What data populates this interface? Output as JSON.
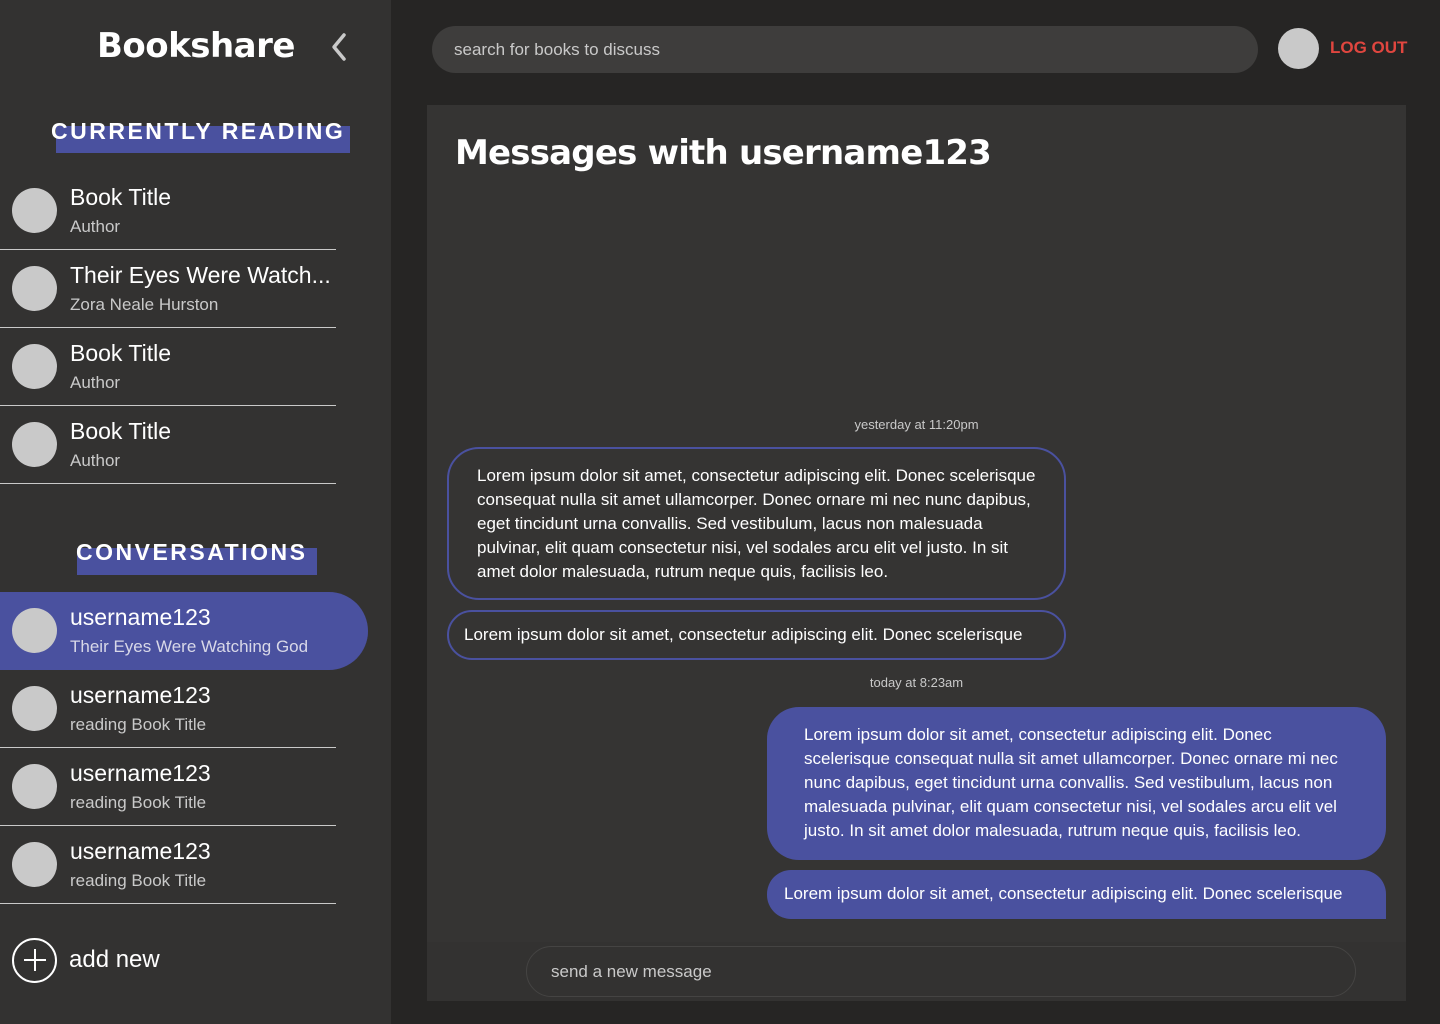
{
  "app": {
    "brand": "Bookshare"
  },
  "sidebar": {
    "currently_reading_heading": "CURRENTLY READING",
    "books": [
      {
        "title": "Book Title",
        "author": "Author"
      },
      {
        "title": "Their Eyes Were Watch...",
        "author": "Zora Neale Hurston"
      },
      {
        "title": "Book Title",
        "author": "Author"
      },
      {
        "title": "Book Title",
        "author": "Author"
      }
    ],
    "conversations_heading": "CONVERSATIONS",
    "conversations": [
      {
        "user": "username123",
        "subtitle": "Their Eyes Were Watching God",
        "active": true
      },
      {
        "user": "username123",
        "subtitle": "reading Book Title",
        "active": false
      },
      {
        "user": "username123",
        "subtitle": "reading Book Title",
        "active": false
      },
      {
        "user": "username123",
        "subtitle": "reading Book Title",
        "active": false
      }
    ],
    "add_new_label": "add new"
  },
  "header": {
    "search_placeholder": "search for books to discuss",
    "logout_label": "LOG OUT"
  },
  "chat": {
    "title": "Messages with username123",
    "timestamp_1": "yesterday at 11:20pm",
    "timestamp_2": "today at 8:23am",
    "messages": [
      {
        "direction": "in",
        "text": "Lorem ipsum dolor sit amet, consectetur adipiscing elit. Donec scelerisque consequat nulla sit amet ullamcorper. Donec ornare mi nec nunc dapibus, eget tincidunt urna convallis. Sed vestibulum, lacus non malesuada pulvinar, elit quam consectetur nisi, vel sodales arcu elit vel justo. In sit amet dolor malesuada, rutrum neque quis, facilisis leo."
      },
      {
        "direction": "in",
        "text": "Lorem ipsum dolor sit amet, consectetur adipiscing elit. Donec scelerisque"
      },
      {
        "direction": "out",
        "text": "Lorem ipsum dolor sit amet, consectetur adipiscing elit. Donec scelerisque consequat nulla sit amet ullamcorper. Donec ornare mi nec nunc dapibus, eget tincidunt urna convallis. Sed vestibulum, lacus non malesuada pulvinar, elit quam consectetur nisi, vel sodales arcu elit vel justo. In sit amet dolor malesuada, rutrum neque quis, facilisis leo."
      },
      {
        "direction": "out",
        "text": "Lorem ipsum dolor sit amet, consectetur adipiscing elit. Donec scelerisque"
      }
    ],
    "composer_placeholder": "send a new message"
  },
  "colors": {
    "accent": "#4a519f",
    "logout": "#e0463f",
    "sidebar_bg": "#333231",
    "page_bg": "#262524",
    "panel_bg": "#353433"
  },
  "icons": {
    "collapse": "chevron-left-icon",
    "add": "plus-circle-icon"
  }
}
